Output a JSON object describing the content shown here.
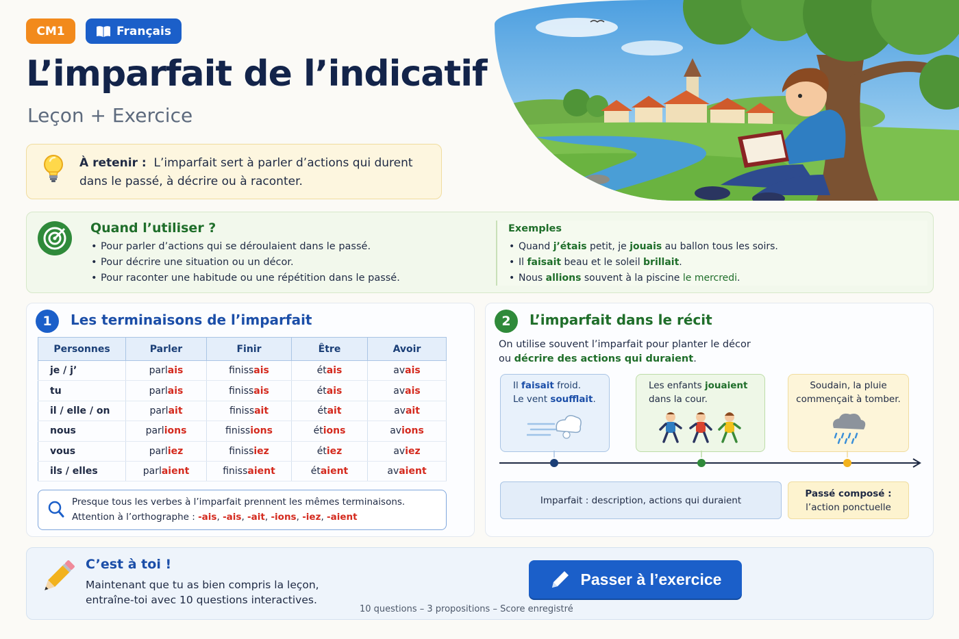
{
  "header": {
    "level_badge": "CM1",
    "subject_badge": "Français",
    "title": "L’imparfait de l’indicatif",
    "subtitle": "Leçon + Exercice"
  },
  "retenir": {
    "label": "À retenir :",
    "text_line1": "L’imparfait sert à parler d’actions qui durent",
    "text_line2": "dans le passé, à décrire ou à raconter."
  },
  "quand": {
    "title": "Quand l’utiliser ?",
    "bullets": [
      "Pour parler d’actions qui se déroulaient dans le passé.",
      "Pour décrire une situation ou un décor.",
      "Pour raconter une habitude ou une répétition dans le passé."
    ],
    "exemples_title": "Exemples",
    "ex1": {
      "a": "Quand ",
      "b": "j’étais",
      "c": " petit, je ",
      "d": "jouais",
      "e": " au ballon tous les soirs."
    },
    "ex2": {
      "a": "Il ",
      "b": "faisait",
      "c": " beau et le soleil ",
      "d": "brillait",
      "e": "."
    },
    "ex3": {
      "a": "Nous ",
      "b": "allions",
      "c": " souvent à la piscine ",
      "d": "le mercredi",
      "e": "."
    }
  },
  "section1": {
    "number": "1",
    "title": "Les terminaisons de l’imparfait",
    "headers": [
      "Personnes",
      "Parler",
      "Finir",
      "Être",
      "Avoir"
    ],
    "rows": [
      {
        "p": "je / j’",
        "c": [
          [
            "parl",
            "ais"
          ],
          [
            "finiss",
            "ais"
          ],
          [
            "ét",
            "ais"
          ],
          [
            "av",
            "ais"
          ]
        ]
      },
      {
        "p": "tu",
        "c": [
          [
            "parl",
            "ais"
          ],
          [
            "finiss",
            "ais"
          ],
          [
            "ét",
            "ais"
          ],
          [
            "av",
            "ais"
          ]
        ]
      },
      {
        "p": "il / elle / on",
        "c": [
          [
            "parl",
            "ait"
          ],
          [
            "finiss",
            "ait"
          ],
          [
            "ét",
            "ait"
          ],
          [
            "av",
            "ait"
          ]
        ]
      },
      {
        "p": "nous",
        "c": [
          [
            "parl",
            "ions"
          ],
          [
            "finiss",
            "ions"
          ],
          [
            "ét",
            "ions"
          ],
          [
            "av",
            "ions"
          ]
        ]
      },
      {
        "p": "vous",
        "c": [
          [
            "parl",
            "iez"
          ],
          [
            "finiss",
            "iez"
          ],
          [
            "ét",
            "iez"
          ],
          [
            "av",
            "iez"
          ]
        ]
      },
      {
        "p": "ils / elles",
        "c": [
          [
            "parl",
            "aient"
          ],
          [
            "finiss",
            "aient"
          ],
          [
            "ét",
            "aient"
          ],
          [
            "av",
            "aient"
          ]
        ]
      }
    ],
    "note_line1": "Presque tous les verbes à l’imparfait prennent les mêmes terminaisons.",
    "note_prefix": "Attention à l’orthographe : ",
    "note_endings": [
      "-ais",
      "-ais",
      "-ait",
      "-ions",
      "-iez",
      "-aient"
    ]
  },
  "section2": {
    "number": "2",
    "title": "L’imparfait dans le récit",
    "intro_line1": "On utilise souvent l’imparfait pour planter le décor",
    "intro_prefix": "ou ",
    "intro_bold": "décrire des actions qui duraient",
    "intro_suffix": ".",
    "card1": {
      "a": "Il ",
      "b": "faisait",
      "c": " froid.",
      "d": "Le vent ",
      "e": "soufflait",
      "f": "."
    },
    "card2": {
      "a": "Les enfants ",
      "b": "jouaient",
      "c": "dans la cour."
    },
    "card3": {
      "a": "Soudain, la pluie",
      "b": "commençait",
      "c": " à tomber."
    },
    "legend_imparfait": "Imparfait : description, actions qui duraient",
    "legend_pc_title": "Passé composé :",
    "legend_pc_text": "l’action ponctuelle"
  },
  "bottom": {
    "title": "C’est à toi !",
    "text": "Maintenant que tu as bien compris la leçon, entraîne-toi avec 10 questions interactives.",
    "cta_label": "Passer à l’exercice",
    "cta_sub": "10 questions – 3 propositions – Score enregistré"
  },
  "colors": {
    "orange": "#f28a1c",
    "blue": "#1b5fc9",
    "green": "#1f6e2a",
    "ending_red": "#d42a1e"
  }
}
